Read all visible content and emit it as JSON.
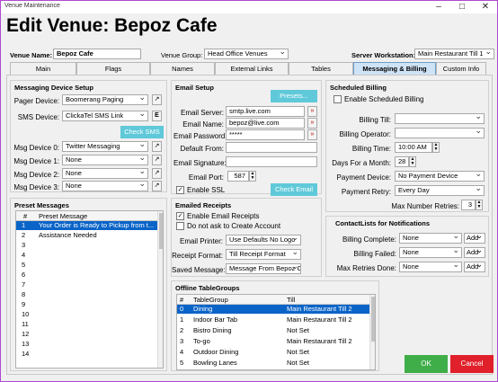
{
  "window": {
    "title": "Venue Maintenance",
    "heading": "Edit Venue: Bepoz Cafe"
  },
  "top": {
    "venue_name_label": "Venue Name:",
    "venue_name_value": "Bepoz Cafe",
    "venue_group_label": "Venue Group:",
    "venue_group_value": "Head Office Venues",
    "server_ws_label": "Server Workstation:",
    "server_ws_value": "Main Restaurant Till 1"
  },
  "tabs": [
    "Main",
    "Flags",
    "Names",
    "External Links",
    "Tables",
    "Messaging & Billing",
    "Custom Info"
  ],
  "messaging": {
    "title": "Messaging Device Setup",
    "pager_label": "Pager Device:",
    "pager_value": "Boomerang Paging",
    "sms_label": "SMS Device:",
    "sms_value": "ClickaTel SMS Link",
    "e_button": "E",
    "check_sms": "Check SMS",
    "msg_devices": [
      {
        "label": "Msg Device 0:",
        "value": "Twitter Messaging"
      },
      {
        "label": "Msg Device 1:",
        "value": "None"
      },
      {
        "label": "Msg Device 2:",
        "value": "None"
      },
      {
        "label": "Msg Device 3:",
        "value": "None"
      }
    ]
  },
  "preset": {
    "title": "Preset Messages",
    "col_num": "#",
    "col_msg": "Preset Message",
    "rows": [
      {
        "n": "1",
        "m": "Your Order is Ready to Pickup from t..."
      },
      {
        "n": "2",
        "m": "Assistance Needed"
      },
      {
        "n": "3",
        "m": ""
      },
      {
        "n": "4",
        "m": ""
      },
      {
        "n": "5",
        "m": ""
      },
      {
        "n": "6",
        "m": ""
      },
      {
        "n": "7",
        "m": ""
      },
      {
        "n": "8",
        "m": ""
      },
      {
        "n": "9",
        "m": ""
      },
      {
        "n": "10",
        "m": ""
      },
      {
        "n": "11",
        "m": ""
      },
      {
        "n": "12",
        "m": ""
      },
      {
        "n": "13",
        "m": ""
      },
      {
        "n": "14",
        "m": ""
      }
    ]
  },
  "email": {
    "title": "Email Setup",
    "presets_btn": "Presets...",
    "server_label": "Email Server:",
    "server_value": "smtp.live.com",
    "name_label": "Email Name:",
    "name_value": "bepoz@live.com",
    "password_label": "Email Password:",
    "password_value": "*****",
    "from_label": "Default From:",
    "from_value": "",
    "sig_label": "Email Signature:",
    "sig_value": "",
    "port_label": "Email Port:",
    "port_value": "587",
    "ssl_label": "Enable SSL",
    "check_email": "Check Email"
  },
  "receipts": {
    "title": "Emailed Receipts",
    "enable_label": "Enable Email Receipts",
    "noask_label": "Do not ask to Create Account",
    "printer_label": "Email Printer:",
    "printer_value": "Use Defaults No Logo",
    "format_label": "Receipt Format:",
    "format_value": "Till Receipt Format",
    "saved_label": "Saved Message:",
    "saved_value": "Message From Bepoz Cafe"
  },
  "offline": {
    "title": "Offline TableGroups",
    "col_num": "#",
    "col_group": "TableGroup",
    "col_till": "Till",
    "rows": [
      {
        "n": "0",
        "g": "Dining",
        "t": "Main Restaurant Till 2"
      },
      {
        "n": "1",
        "g": "Indoor Bar Tab",
        "t": "Main Restaurant Till 2"
      },
      {
        "n": "2",
        "g": "Bistro Dining",
        "t": "Not Set"
      },
      {
        "n": "3",
        "g": "To-go",
        "t": "Main Restaurant Till 2"
      },
      {
        "n": "4",
        "g": "Outdoor Dining",
        "t": "Not Set"
      },
      {
        "n": "5",
        "g": "Bowling Lanes",
        "t": "Not Set"
      }
    ]
  },
  "billing": {
    "title": "Scheduled Billing",
    "enable_label": "Enable Scheduled Billing",
    "till_label": "Billing Till:",
    "till_value": "",
    "operator_label": "Billing Operator:",
    "operator_value": "",
    "time_label": "Billing Time:",
    "time_value": "10:00 AM",
    "days_label": "Days For a Month:",
    "days_value": "28",
    "payment_device_label": "Payment Device:",
    "payment_device_value": "No Payment Device",
    "payment_retry_label": "Payment Retry:",
    "payment_retry_value": "Every Day",
    "max_retries_label": "Max Number Retries:",
    "max_retries_value": "3"
  },
  "contacts": {
    "title": "ContactLists for Notifications",
    "rows": [
      {
        "label": "Billing Complete:",
        "value": "None",
        "add": "Add"
      },
      {
        "label": "Billing Failed:",
        "value": "None",
        "add": "Add"
      },
      {
        "label": "Max Retries Done:",
        "value": "None",
        "add": "Add"
      }
    ]
  },
  "footer": {
    "ok": "OK",
    "cancel": "Cancel"
  },
  "colors": {
    "accent": "#5fc9d9",
    "ok": "#3fae49",
    "cancel": "#e0202a",
    "selection": "#0a64c8"
  }
}
